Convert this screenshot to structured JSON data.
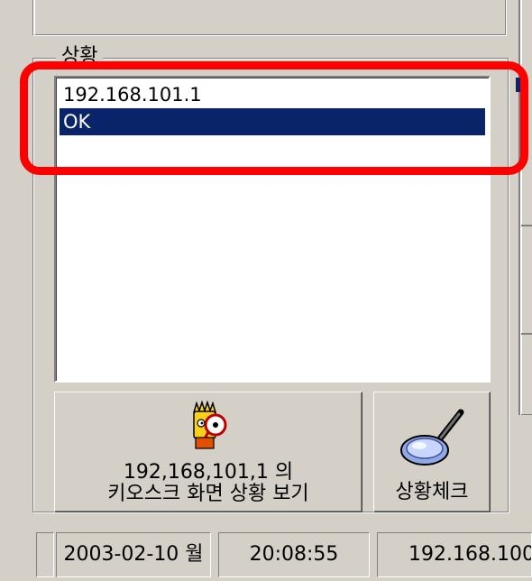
{
  "status_group": {
    "title": "상황",
    "items": [
      {
        "text": "192.168.101.1",
        "selected": false
      },
      {
        "text": "OK",
        "selected": true
      }
    ]
  },
  "buttons": {
    "view_kiosk": {
      "line1": "192,168,101,1 의",
      "line2": "키오스크 화면 상황 보기",
      "icon": "cartoon-character-magnifier-icon"
    },
    "status_check": {
      "label": "상황체크",
      "icon": "magnifying-glass-icon"
    }
  },
  "statusbar": {
    "date": "2003-02-10 월",
    "time": "20:08:55",
    "ip": "192.168.100"
  },
  "colors": {
    "selection": "#0a246a",
    "face": "#d4d0c8",
    "annotation": "#ff0000"
  }
}
